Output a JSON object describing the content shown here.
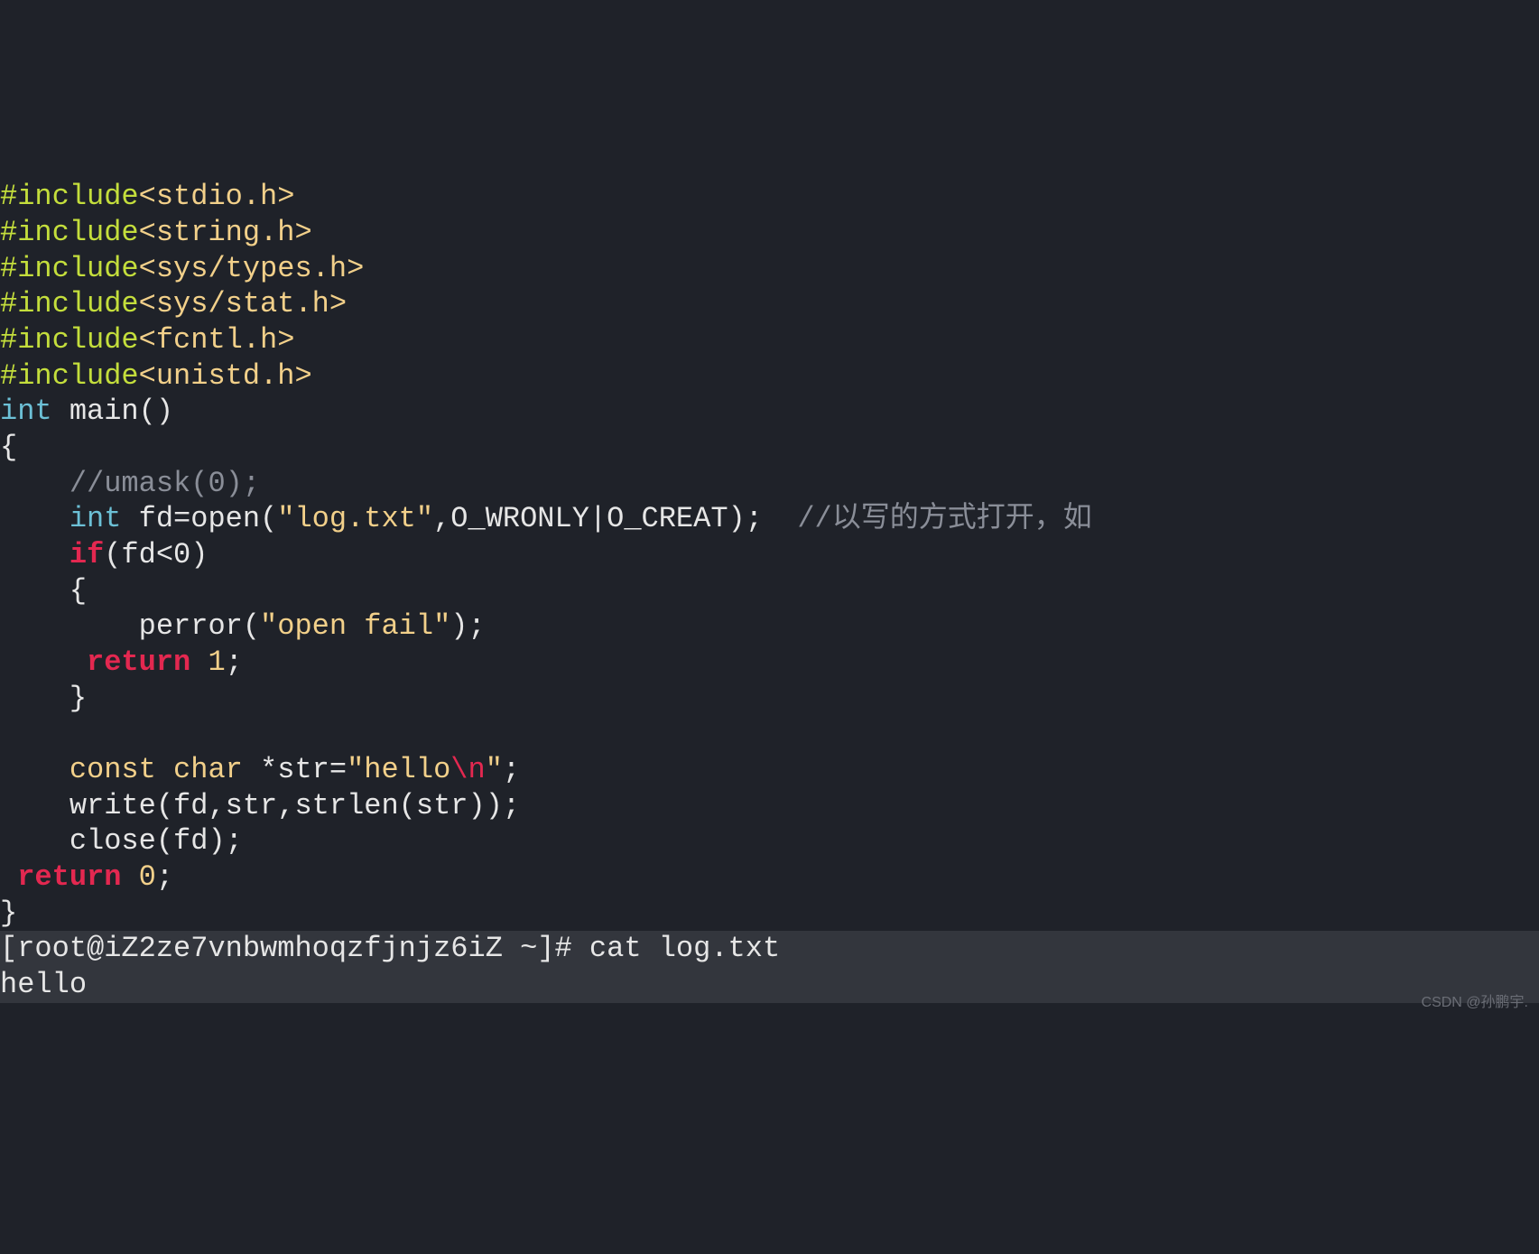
{
  "code": {
    "inc_kw1": "#include",
    "inc_h1": "<stdio.h>",
    "inc_kw2": "#include",
    "inc_h2": "<string.h>",
    "inc_kw3": "#include",
    "inc_h3": "<sys/types.h>",
    "inc_kw4": "#include",
    "inc_h4": "<sys/stat.h>",
    "inc_kw5": "#include",
    "inc_h5": "<fcntl.h>",
    "inc_kw6": "#include",
    "inc_h6": "<unistd.h>",
    "type_int": "int",
    "main_sig": " main()",
    "brace_open": "{",
    "umask_cmt": "    //umask(0);",
    "l_int": "    int",
    "l_open": " fd=open(",
    "l_open_str": "\"log.txt\"",
    "l_open_flags": ",O_WRONLY|O_CREAT);  ",
    "l_open_cmt": "//以写的方式打开，如",
    "if_kw": "    if",
    "if_cond": "(fd<0)",
    "brace2": "    {",
    "perror": "        perror(",
    "perror_str": "\"open fail\"",
    "perror_end": ");",
    "ret1_pad": "     ",
    "ret1_kw": "return",
    "ret1_sp": " ",
    "ret1_num": "1",
    "ret1_semi": ";",
    "brace3": "    }",
    "blank": "",
    "const_kw": "    const",
    "char_kw": " char",
    "str_decl": " *str=",
    "str_lit_open": "\"hello",
    "str_esc": "\\n",
    "str_lit_close": "\"",
    "str_semi": ";",
    "write_call": "    write(fd,str,strlen(str));",
    "close_call": "    close(fd);",
    "ret0_pad": " ",
    "ret0_kw": "return",
    "ret0_sp": " ",
    "ret0_num": "0",
    "ret0_semi": ";",
    "brace_close": "}"
  },
  "term": {
    "prompt": "[root@iZ2ze7vnbwmhoqzfjnjz6iZ ~]# ",
    "cmd": "cat log.txt",
    "output": "hello"
  },
  "watermark": "CSDN @孙鹏宇."
}
